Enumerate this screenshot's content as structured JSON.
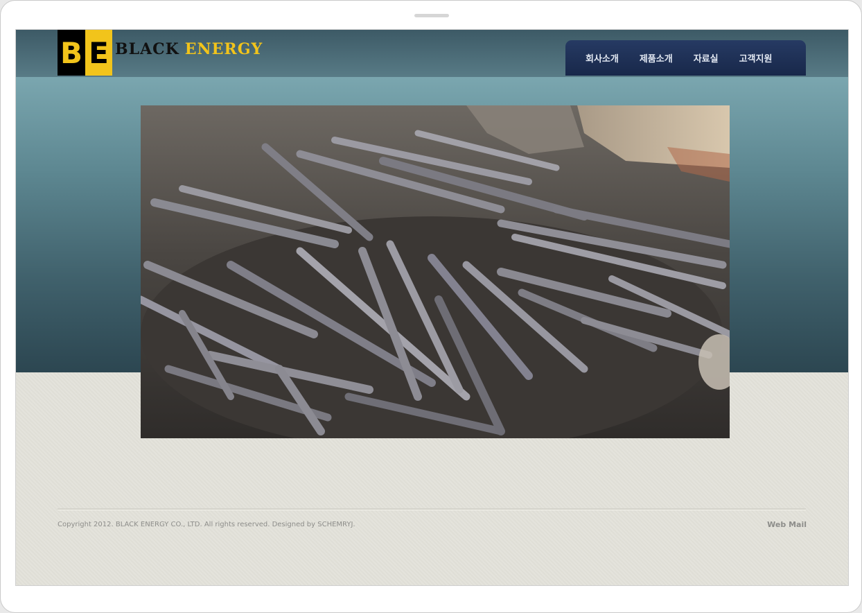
{
  "logo": {
    "letter_b": "B",
    "letter_e": "E",
    "word_black": "BLACK",
    "word_energy": "ENERGY"
  },
  "nav": {
    "items": [
      "회사소개",
      "제품소개",
      "자료실",
      "고객지원"
    ]
  },
  "hero": {
    "image_subject": "pile of charcoal sticks"
  },
  "footer": {
    "copyright": "Copyright 2012. BLACK ENERGY CO., LTD. All rights reserved. Designed by SCHEMRYJ.",
    "webmail": "Web Mail"
  },
  "colors": {
    "brand_yellow": "#f2c41b",
    "nav_navy": "#1f3157",
    "hero_teal": "#5d8791",
    "page_bg": "#e3e2da"
  }
}
